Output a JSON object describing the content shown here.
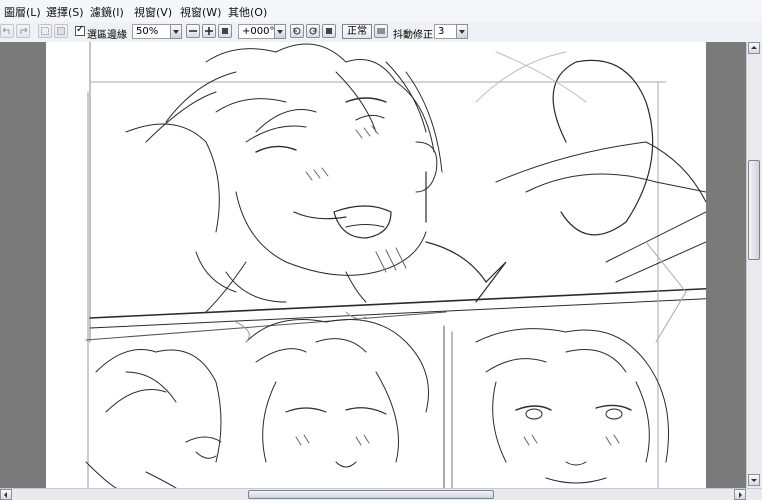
{
  "menu": {
    "items": [
      {
        "label": "圖層(L)"
      },
      {
        "label": "選擇(S)"
      },
      {
        "label": "濾鏡(I)"
      },
      {
        "label": "視窗(V)"
      },
      {
        "label": "視窗(W)"
      },
      {
        "label": "其他(O)"
      }
    ]
  },
  "toolbar": {
    "selection_edge_label": "選區邊緣",
    "selection_edge_checked": true,
    "zoom_value": "50%",
    "rotation_value": "+000°",
    "blend_mode_label": "正常",
    "stabilizer_label": "抖動修正",
    "stabilizer_value": "3"
  },
  "colors": {
    "menubar_bg": "#f4f6f9",
    "toolbar_bg": "#eef1f5",
    "workspace_bg": "#7a7a7a",
    "canvas_bg": "#ffffff",
    "sketch_stroke": "#2b2b2b"
  }
}
